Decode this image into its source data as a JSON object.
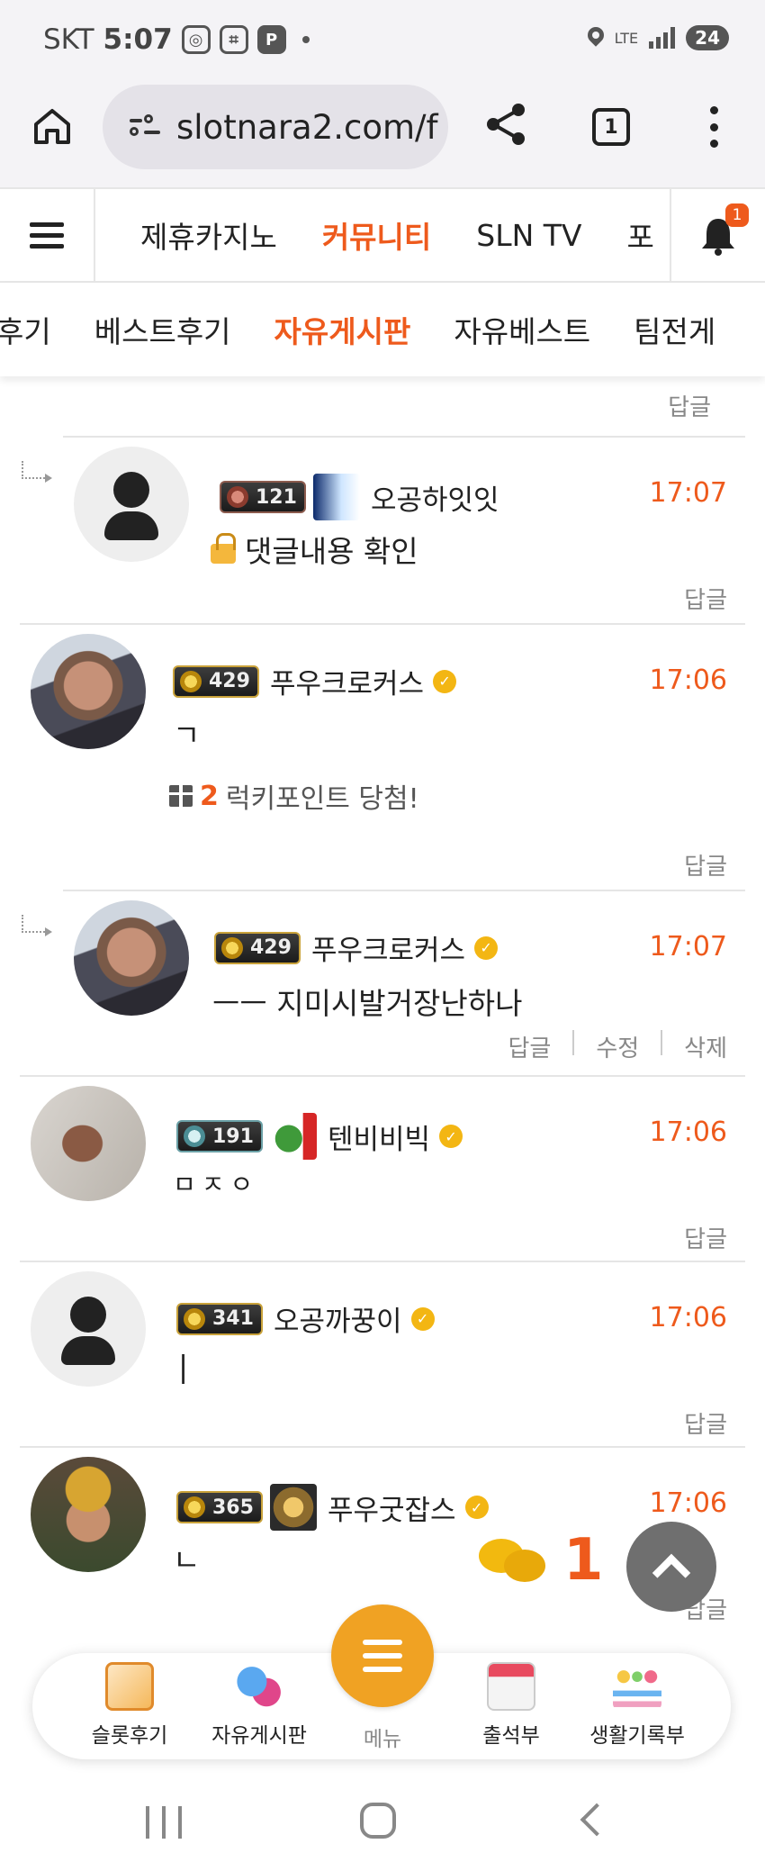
{
  "status_bar": {
    "carrier": "SKT",
    "time": "5:07",
    "network": "LTE",
    "battery": "24",
    "icons": [
      "location-pin-icon",
      "screenshot-icon",
      "parking-icon",
      "notification-dot-icon"
    ]
  },
  "browser": {
    "url": "slotnara2.com/f",
    "tab_count": "1",
    "icons": [
      "home-icon",
      "site-settings-icon",
      "share-icon",
      "tabs-icon",
      "more-icon"
    ]
  },
  "site_nav": {
    "items": [
      "제휴카지노",
      "커뮤니티",
      "SLN TV",
      "포"
    ],
    "active": "커뮤니티",
    "notification_count": "1"
  },
  "sub_nav": {
    "items": [
      "후기",
      "베스트후기",
      "자유게시판",
      "자유베스트",
      "팀전게"
    ],
    "active": "자유게시판"
  },
  "top_reply_label": "답글",
  "comments": [
    {
      "is_reply": true,
      "avatar": "default-avatar-icon",
      "level": "121",
      "nickname": "오공하잇잇",
      "verified": false,
      "time": "17:07",
      "content": "댓글내용 확인",
      "locked": true,
      "actions": [
        "답글"
      ]
    },
    {
      "is_reply": false,
      "avatar": "profile-photo",
      "level": "429",
      "nickname": "푸우크로커스",
      "verified": true,
      "time": "17:06",
      "content": "ㄱ",
      "lucky_points": "2",
      "lucky_text": "럭키포인트 당첨!",
      "actions": [
        "답글"
      ]
    },
    {
      "is_reply": true,
      "avatar": "profile-photo",
      "level": "429",
      "nickname": "푸우크로커스",
      "verified": true,
      "time": "17:07",
      "content": "ㅡㅡ 지미시발거장난하나",
      "actions": [
        "답글",
        "수정",
        "삭제"
      ]
    },
    {
      "is_reply": false,
      "avatar": "profile-photo",
      "level": "191",
      "nickname": "텐비비빅",
      "verified": true,
      "time": "17:06",
      "content": "ㅁㅈㅇ",
      "actions": [
        "답글"
      ]
    },
    {
      "is_reply": false,
      "avatar": "default-avatar-icon",
      "level": "341",
      "nickname": "오공까꿍이",
      "verified": true,
      "time": "17:06",
      "content": "|",
      "actions": [
        "답글"
      ]
    },
    {
      "is_reply": false,
      "avatar": "profile-photo",
      "level": "365",
      "nickname": "푸우굿잡스",
      "verified": true,
      "time": "17:06",
      "content": "ㄴ",
      "actions": [
        "답글"
      ]
    }
  ],
  "floating": {
    "chat_count": "1",
    "icons": [
      "chat-bubbles-icon",
      "scroll-top-icon"
    ]
  },
  "bottom_menu": {
    "items": [
      "슬롯후기",
      "자유게시판",
      "메뉴",
      "출석부",
      "생활기록부"
    ]
  },
  "colors": {
    "accent": "#ee5a1c",
    "menu_button": "#f0a223",
    "verified": "#f3b613"
  }
}
